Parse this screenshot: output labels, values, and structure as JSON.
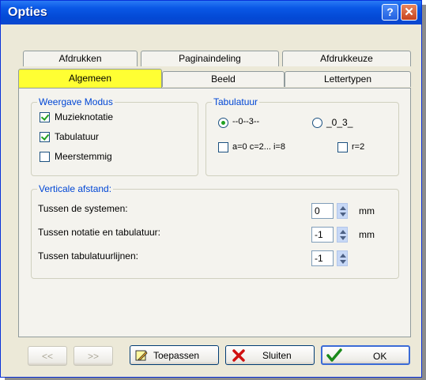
{
  "window": {
    "title": "Opties"
  },
  "tabs_back": [
    "Afdrukken",
    "Paginaindeling",
    "Afdrukkeuze"
  ],
  "tabs_front": [
    "Algemeen",
    "Beeld",
    "Lettertypen"
  ],
  "weergave": {
    "legend": "Weergave Modus",
    "items": [
      {
        "label": "Muzieknotatie",
        "checked": true
      },
      {
        "label": "Tabulatuur",
        "checked": true
      },
      {
        "label": "Meerstemmig",
        "checked": false
      }
    ]
  },
  "tabulatuur": {
    "legend": "Tabulatuur",
    "radio1": "--0--3--",
    "radio2": "_0_3_",
    "check1": "a=0 c=2... i=8",
    "check2": "r=2"
  },
  "verticale": {
    "legend": "Verticale afstand:",
    "rows": [
      {
        "label": "Tussen de systemen:",
        "value": "0",
        "unit": "mm"
      },
      {
        "label": "Tussen notatie en tabulatuur:",
        "value": "-1",
        "unit": "mm"
      },
      {
        "label": "Tussen tabulatuurlijnen:",
        "value": "-1",
        "unit": ""
      }
    ]
  },
  "buttons": {
    "prev": "<<",
    "next": ">>",
    "apply": "Toepassen",
    "close": "Sluiten",
    "ok": "OK"
  },
  "colors": {
    "title_bar": "#0a58e6",
    "active_tab": "#ffff33",
    "legend": "#0046d5"
  }
}
